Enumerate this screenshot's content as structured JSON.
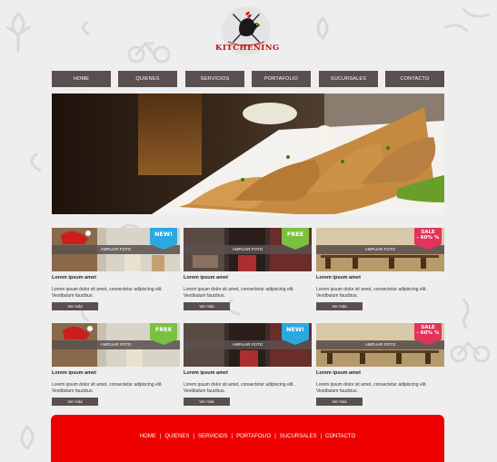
{
  "brand": {
    "name": "KITCHENING",
    "accent": "#c11010"
  },
  "nav": {
    "items": [
      {
        "label": "HOME"
      },
      {
        "label": "QUIENES"
      },
      {
        "label": "SERVICIOS"
      },
      {
        "label": "PORTAFOLIO"
      },
      {
        "label": "SUCURSALES"
      },
      {
        "label": "CONTACTO"
      }
    ]
  },
  "cards": [
    {
      "ribbon": "NEW!",
      "ribbon_color": "#29a9e0",
      "overlay": "AMPLIAR FOTO",
      "title": "Lorem ipsum amet",
      "text": "Lorem ipsum dolor sit amet, consectetur adipiscing elit. Vestibulum faucibus.",
      "button": "Ver más"
    },
    {
      "ribbon": "FREE",
      "ribbon_color": "#7ac142",
      "overlay": "AMPLIAR FOTO",
      "title": "Lorem ipsum amet",
      "text": "Lorem ipsum dolor sit amet, consectetur adipiscing elit. Vestibulum faucibus.",
      "button": "Ver más"
    },
    {
      "ribbon": "SALE - 60% %",
      "ribbon_line1": "SALE",
      "ribbon_line2": "- 60% %",
      "ribbon_color": "#e2335a",
      "overlay": "AMPLIAR FOTO",
      "title": "Lorem ipsum amet",
      "text": "Lorem ipsum dolor sit amet, consectetur adipiscing elit. Vestibulum faucibus.",
      "button": "Ver más"
    },
    {
      "ribbon": "FREE",
      "ribbon_color": "#7ac142",
      "overlay": "AMPLIAR FOTO",
      "title": "Lorem ipsum amet",
      "text": "Lorem ipsum dolor sit amet, consectetur adipiscing elit. Vestibulum faucibus.",
      "button": "Ver más"
    },
    {
      "ribbon": "NEW!",
      "ribbon_color": "#29a9e0",
      "overlay": "AMPLIAR FOTO",
      "title": "Lorem ipsum amet",
      "text": "Lorem ipsum dolor sit amet, consectetur adipiscing elit. Vestibulum faucibus.",
      "button": "Ver más"
    },
    {
      "ribbon": "SALE - 60% %",
      "ribbon_line1": "SALE",
      "ribbon_line2": "- 60% %",
      "ribbon_color": "#e2335a",
      "overlay": "AMPLIAR FOTO",
      "title": "Lorem ipsum amet",
      "text": "Lorem ipsum dolor sit amet, consectetur adipiscing elit. Vestibulum faucibus.",
      "button": "Ver más"
    }
  ],
  "footer": {
    "bg_color": "#ee0000",
    "links": [
      "HOME",
      "QUIENES",
      "SERVICIOS",
      "PORTAFOLIO",
      "SUCURSALES",
      "CONTACTO"
    ],
    "separator": "|"
  },
  "icons": [
    "chef-rooster-logo-icon",
    "leaf-pattern-icon",
    "bicycle-pattern-icon",
    "mustache-pattern-icon"
  ]
}
